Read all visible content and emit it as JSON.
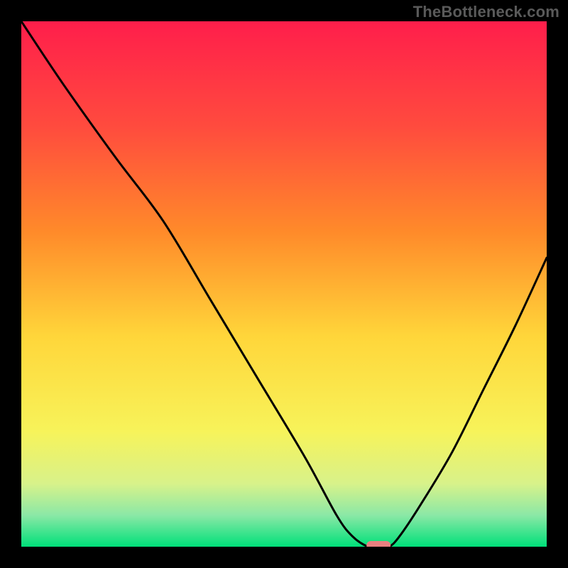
{
  "watermark": "TheBottleneck.com",
  "chart_data": {
    "type": "line",
    "title": "",
    "xlabel": "",
    "ylabel": "",
    "xlim": [
      0,
      100
    ],
    "ylim": [
      0,
      100
    ],
    "grid": false,
    "legend": false,
    "series": [
      {
        "name": "bottleneck-curve",
        "x": [
          0,
          8,
          18,
          27,
          36,
          45,
          54,
          60,
          63,
          66,
          68,
          70,
          72,
          76,
          82,
          88,
          94,
          100
        ],
        "y": [
          100,
          88,
          74,
          62,
          47,
          32,
          17,
          6,
          2,
          0,
          0,
          0,
          2,
          8,
          18,
          30,
          42,
          55
        ]
      }
    ],
    "marker": {
      "x": 68,
      "y": 0,
      "color": "#e88080"
    },
    "gradient_stops": [
      {
        "offset": 0.0,
        "color": "#ff1e4b"
      },
      {
        "offset": 0.2,
        "color": "#ff4b3e"
      },
      {
        "offset": 0.4,
        "color": "#ff8a2a"
      },
      {
        "offset": 0.6,
        "color": "#ffd63a"
      },
      {
        "offset": 0.78,
        "color": "#f7f35a"
      },
      {
        "offset": 0.88,
        "color": "#d8f28a"
      },
      {
        "offset": 0.94,
        "color": "#8be8a6"
      },
      {
        "offset": 1.0,
        "color": "#00e07a"
      }
    ]
  }
}
